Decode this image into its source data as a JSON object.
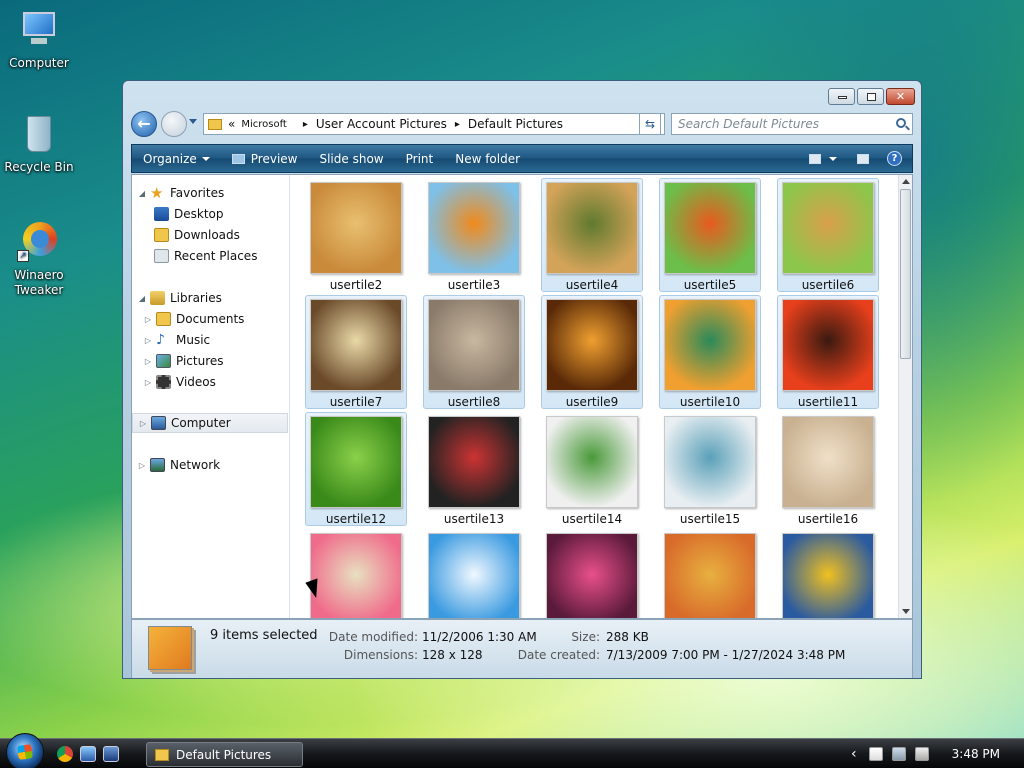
{
  "desktop": {
    "icons": [
      {
        "label": "Computer"
      },
      {
        "label": "Recycle Bin"
      },
      {
        "label": "Winaero Tweaker"
      }
    ]
  },
  "window": {
    "address": {
      "overflow": "«",
      "crumbs": [
        "Microsoft",
        "User Account Pictures",
        "Default Pictures"
      ]
    },
    "search": {
      "placeholder": "Search Default Pictures"
    },
    "toolbar": {
      "organize": "Organize",
      "preview": "Preview",
      "slideshow": "Slide show",
      "print": "Print",
      "new_folder": "New folder"
    },
    "navigation": {
      "favorites": "Favorites",
      "desktop": "Desktop",
      "downloads": "Downloads",
      "recent_places": "Recent Places",
      "libraries": "Libraries",
      "documents": "Documents",
      "music": "Music",
      "pictures": "Pictures",
      "videos": "Videos",
      "computer": "Computer",
      "network": "Network"
    },
    "files": [
      {
        "name": "usertile2",
        "selected": false,
        "colors": [
          "#c98a3a",
          "#e8c070"
        ]
      },
      {
        "name": "usertile3",
        "selected": false,
        "colors": [
          "#7ec0e8",
          "#f08a1c"
        ]
      },
      {
        "name": "usertile4",
        "selected": true,
        "colors": [
          "#d4a35a",
          "#5f7a2e"
        ]
      },
      {
        "name": "usertile5",
        "selected": true,
        "colors": [
          "#6bbf4a",
          "#e85a1e"
        ]
      },
      {
        "name": "usertile6",
        "selected": true,
        "colors": [
          "#8cc64a",
          "#d9a04a"
        ]
      },
      {
        "name": "usertile7",
        "selected": true,
        "colors": [
          "#6b4a2a",
          "#e9d9a8"
        ]
      },
      {
        "name": "usertile8",
        "selected": true,
        "colors": [
          "#8a7a6a",
          "#c8b8a0"
        ]
      },
      {
        "name": "usertile9",
        "selected": true,
        "colors": [
          "#5a2a08",
          "#f0a030"
        ]
      },
      {
        "name": "usertile10",
        "selected": true,
        "colors": [
          "#f0a030",
          "#2a8a5a"
        ]
      },
      {
        "name": "usertile11",
        "selected": true,
        "colors": [
          "#e8401c",
          "#3a1a10"
        ]
      },
      {
        "name": "usertile12",
        "selected": true,
        "colors": [
          "#3a8a1a",
          "#8ad04a"
        ]
      },
      {
        "name": "usertile13",
        "selected": false,
        "colors": [
          "#222222",
          "#cc3333"
        ]
      },
      {
        "name": "usertile14",
        "selected": false,
        "colors": [
          "#f0f0f0",
          "#4a9a3a"
        ]
      },
      {
        "name": "usertile15",
        "selected": false,
        "colors": [
          "#e8eef2",
          "#5aa0b8"
        ]
      },
      {
        "name": "usertile16",
        "selected": false,
        "colors": [
          "#c8b090",
          "#f0e0c8"
        ]
      },
      {
        "name": "",
        "selected": false,
        "colors": [
          "#f06a8a",
          "#e8e0c0"
        ]
      },
      {
        "name": "",
        "selected": false,
        "colors": [
          "#3a9ae0",
          "#f0f8ff"
        ]
      },
      {
        "name": "",
        "selected": false,
        "colors": [
          "#5a1a3a",
          "#e8508a"
        ]
      },
      {
        "name": "",
        "selected": false,
        "colors": [
          "#d86a2a",
          "#e8b040"
        ]
      },
      {
        "name": "",
        "selected": false,
        "colors": [
          "#2a5aa0",
          "#f0c020"
        ]
      }
    ],
    "details": {
      "summary": "9 items selected",
      "date_modified_label": "Date modified:",
      "date_modified": "11/2/2006 1:30 AM",
      "dimensions_label": "Dimensions:",
      "dimensions": "128 x 128",
      "size_label": "Size:",
      "size": "288 KB",
      "date_created_label": "Date created:",
      "date_created": "7/13/2009 7:00 PM - 1/27/2024 3:48 PM"
    }
  },
  "taskbar": {
    "task_label": "Default Pictures",
    "clock": "3:48 PM"
  },
  "colors": {
    "toolbar": "#1e5682",
    "selection": "#d4e7f6",
    "selection_border": "#aacbe5"
  }
}
